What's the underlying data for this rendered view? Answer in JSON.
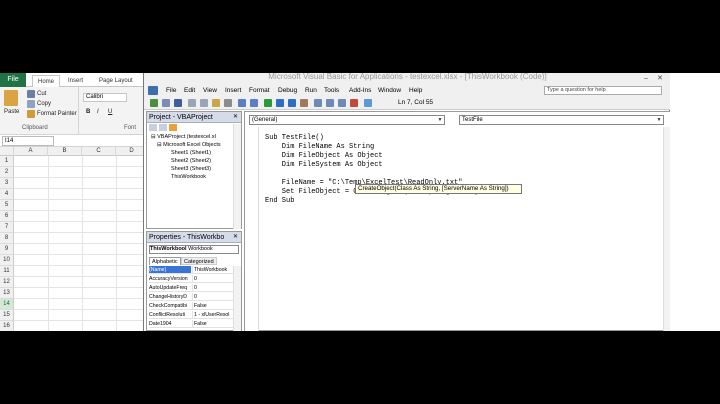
{
  "excel": {
    "tabs": {
      "file": "File",
      "home": "Home",
      "insert": "Insert",
      "page_layout": "Page Layout"
    },
    "ribbon": {
      "paste": "Paste",
      "cut": "Cut",
      "copy": "Copy",
      "format_painter": "Format Painter",
      "clipboard": "Clipboard",
      "font_name": "Calibri",
      "font_group": "Font",
      "bold": "B",
      "italic": "I",
      "underline": "U"
    },
    "name_box": "I14",
    "columns": [
      "A",
      "B",
      "C",
      "D"
    ],
    "rows": [
      "1",
      "2",
      "3",
      "4",
      "5",
      "6",
      "7",
      "8",
      "9",
      "10",
      "11",
      "12",
      "13",
      "14",
      "15",
      "16"
    ],
    "selected_row": "14"
  },
  "vbe": {
    "title": "Microsoft Visual Basic for Applications - testexcel.xlsx - [ThisWorkbook (Code)]",
    "menu": [
      "File",
      "Edit",
      "View",
      "Insert",
      "Format",
      "Debug",
      "Run",
      "Tools",
      "Add-Ins",
      "Window",
      "Help"
    ],
    "ask_placeholder": "Type a question for help",
    "status_position": "Ln 7, Col 55",
    "project": {
      "title": "Project - VBAProject",
      "root": "VBAProject (testexcel.xl",
      "folder": "Microsoft Excel Objects",
      "items": [
        "Sheet1 (Sheet1)",
        "Sheet2 (Sheet2)",
        "Sheet3 (Sheet3)",
        "ThisWorkbook"
      ]
    },
    "properties": {
      "title": "Properties - ThisWorkbo",
      "object": "ThisWorkbool",
      "object_type": "Workbook",
      "tab_alpha": "Alphabetic",
      "tab_cat": "Categorized",
      "rows": [
        {
          "name": "(Name)",
          "value": "ThisWorkbook"
        },
        {
          "name": "AccuracyVersion",
          "value": "0"
        },
        {
          "name": "AutoUpdateFreq",
          "value": "0"
        },
        {
          "name": "ChangeHistoryD",
          "value": "0"
        },
        {
          "name": "CheckCompatibi",
          "value": "False"
        },
        {
          "name": "ConflictResoluti",
          "value": "1 - xlUserResol"
        },
        {
          "name": "Date1904",
          "value": "False"
        }
      ]
    },
    "code": {
      "object_combo": "(General)",
      "proc_combo": "TestFile",
      "lines": [
        "Sub TestFile()",
        "    Dim FileName As String",
        "    Dim FileObject As Object",
        "    Dim FileSystem As Object",
        "",
        "    FileName = \"C:\\Temp\\ExcelTest\\ReadOnly.txt\"",
        "    Set FileObject = CreateObject(\"Scripting.FileSyste",
        "End Sub"
      ],
      "tooltip": "CreateObject(Class As String, [ServerName As String])"
    }
  }
}
